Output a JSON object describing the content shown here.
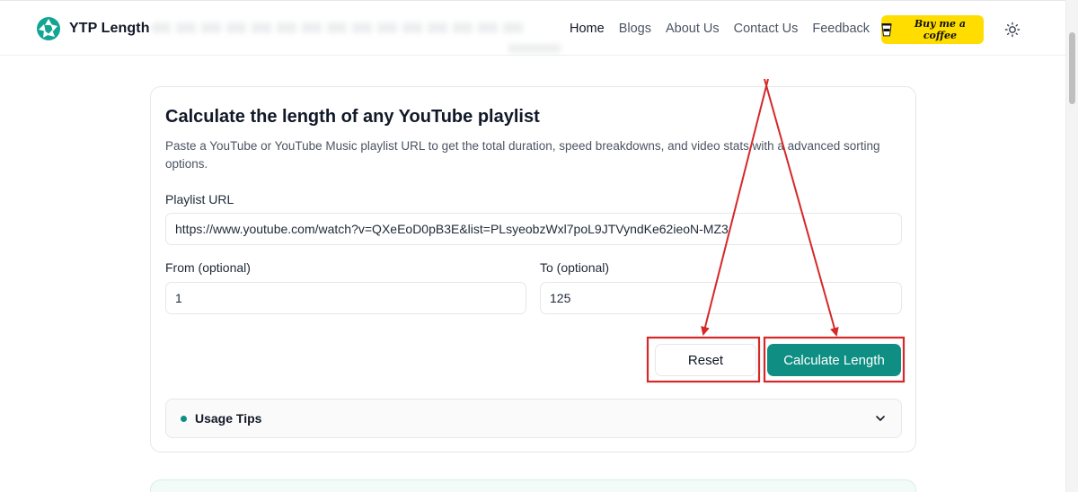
{
  "header": {
    "logo_text": "YTP Length",
    "nav": [
      {
        "label": "Home",
        "active": true
      },
      {
        "label": "Blogs",
        "active": false
      },
      {
        "label": "About Us",
        "active": false
      },
      {
        "label": "Contact Us",
        "active": false
      },
      {
        "label": "Feedback",
        "active": false
      }
    ],
    "coffee_label": "Buy me a coffee",
    "theme_icon": "sun-icon"
  },
  "card": {
    "title": "Calculate the length of any YouTube playlist",
    "description": "Paste a YouTube or YouTube Music playlist URL to get the total duration, speed breakdowns, and video stats with a advanced sorting options.",
    "playlist_label": "Playlist URL",
    "playlist_value": "https://www.youtube.com/watch?v=QXeEoD0pB3E&list=PLsyeobzWxl7poL9JTVyndKe62ieoN-MZ3",
    "from_label": "From (optional)",
    "from_value": "1",
    "to_label": "To (optional)",
    "to_value": "125",
    "reset_label": "Reset",
    "calculate_label": "Calculate Length",
    "tips_label": "Usage Tips"
  },
  "colors": {
    "brand": "#0f8f83",
    "coffee": "#ffdd00",
    "annotation": "#d62828"
  }
}
